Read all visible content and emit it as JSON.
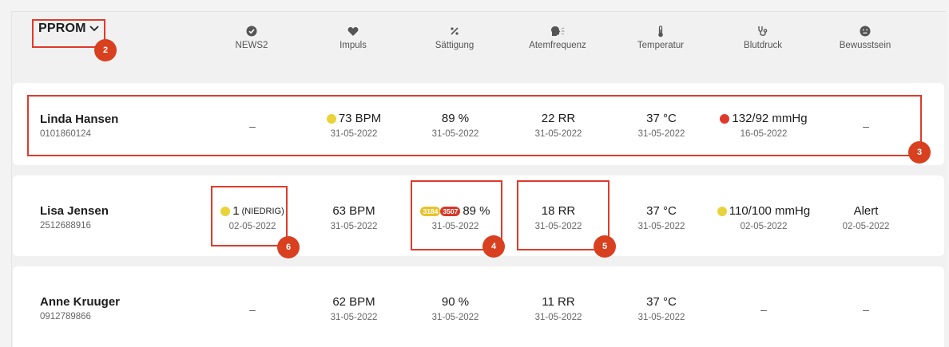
{
  "header": {
    "title": "PPROM",
    "columns": [
      {
        "label": "NEWS2",
        "icon": "check-circle-icon"
      },
      {
        "label": "Impuls",
        "icon": "heart-icon"
      },
      {
        "label": "Sättigung",
        "icon": "percent-icon"
      },
      {
        "label": "Atemfrequenz",
        "icon": "breathing-head-icon"
      },
      {
        "label": "Temperatur",
        "icon": "thermometer-icon"
      },
      {
        "label": "Blutdruck",
        "icon": "stethoscope-icon"
      },
      {
        "label": "Bewusstsein",
        "icon": "face-icon"
      }
    ]
  },
  "patients": [
    {
      "name": "Linda Hansen",
      "id": "0101860124",
      "news2": {
        "value": "–"
      },
      "impuls": {
        "value": "73 BPM",
        "date": "31-05-2022",
        "status": "yellow"
      },
      "saettigung": {
        "value": "89 %",
        "date": "31-05-2022"
      },
      "atem": {
        "value": "22 RR",
        "date": "31-05-2022"
      },
      "temp": {
        "value": "37 °C",
        "date": "31-05-2022"
      },
      "blut": {
        "value": "132/92 mmHg",
        "date": "16-05-2022",
        "status": "red"
      },
      "bewusst": {
        "value": "–"
      }
    },
    {
      "name": "Lisa Jensen",
      "id": "2512688916",
      "news2": {
        "value": "1",
        "qualifier": "(NIEDRIG)",
        "date": "02-05-2022",
        "status": "yellow"
      },
      "impuls": {
        "value": "63 BPM",
        "date": "31-05-2022"
      },
      "saettigung": {
        "value": "89 %",
        "date": "31-05-2022",
        "tag1": "3184",
        "tag2": "3507"
      },
      "atem": {
        "value": "18 RR",
        "date": "31-05-2022"
      },
      "temp": {
        "value": "37 °C",
        "date": "31-05-2022"
      },
      "blut": {
        "value": "110/100 mmHg",
        "date": "02-05-2022",
        "status": "yellow"
      },
      "bewusst": {
        "value": "Alert",
        "date": "02-05-2022"
      }
    },
    {
      "name": "Anne Kruuger",
      "id": "0912789866",
      "news2": {
        "value": "–"
      },
      "impuls": {
        "value": "62 BPM",
        "date": "31-05-2022"
      },
      "saettigung": {
        "value": "90 %",
        "date": "31-05-2022"
      },
      "atem": {
        "value": "11 RR",
        "date": "31-05-2022"
      },
      "temp": {
        "value": "37 °C",
        "date": "31-05-2022"
      },
      "blut": {
        "value": "–"
      },
      "bewusst": {
        "value": "–"
      }
    }
  ],
  "annotations": [
    "2",
    "3",
    "4",
    "5",
    "6"
  ],
  "colors": {
    "yellow": "#e8d43a",
    "red": "#e0392b",
    "annotation": "#e03a2a",
    "tag_yellow": "#e6c32a",
    "tag_red": "#d7392a"
  }
}
